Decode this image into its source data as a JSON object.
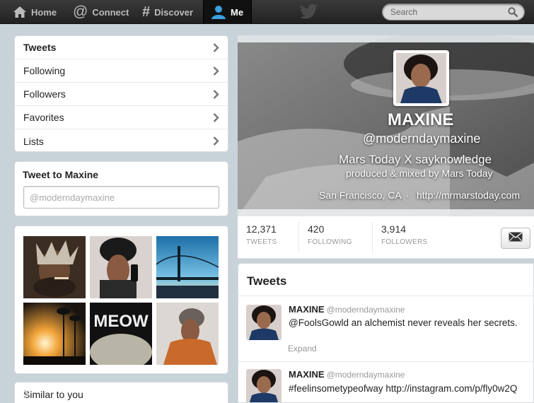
{
  "nav": {
    "home": "Home",
    "connect": "Connect",
    "discover": "Discover",
    "me": "Me"
  },
  "search": {
    "placeholder": "Search"
  },
  "sidebar": {
    "items": [
      {
        "label": "Tweets"
      },
      {
        "label": "Following"
      },
      {
        "label": "Followers"
      },
      {
        "label": "Favorites"
      },
      {
        "label": "Lists"
      }
    ]
  },
  "tweet_to": {
    "title": "Tweet to Maxine",
    "placeholder": "@moderndaymaxine"
  },
  "similar": {
    "title": "Similar to you"
  },
  "profile": {
    "name": "MAXINE",
    "handle": "@moderndaymaxine",
    "bio_line1": "Mars Today X sayknowledge",
    "bio_line2": "produced & mixed by Mars Today",
    "location": "San Francisco, CA",
    "separator": "·",
    "url": "http://mrmarstoday.com"
  },
  "stats": {
    "tweets_count": "12,371",
    "tweets_label": "TWEETS",
    "following_count": "420",
    "following_label": "FOLLOWING",
    "followers_count": "3,914",
    "followers_label": "FOLLOWERS"
  },
  "timeline": {
    "title": "Tweets",
    "items": [
      {
        "name": "MAXINE",
        "handle": "@moderndaymaxine",
        "text": "@FoolsGowld an alchemist never reveals her secrets.",
        "expand": "Expand"
      },
      {
        "name": "MAXINE",
        "handle": "@moderndaymaxine",
        "text": "#feelinsometypeofway  http://instagram.com/p/fly0w2Q"
      }
    ]
  },
  "media": {
    "thumb_text": "MEOW"
  },
  "colors": {
    "topbar": "#2b2b2b",
    "background": "#c8d3d9",
    "panel": "#ffffff"
  }
}
